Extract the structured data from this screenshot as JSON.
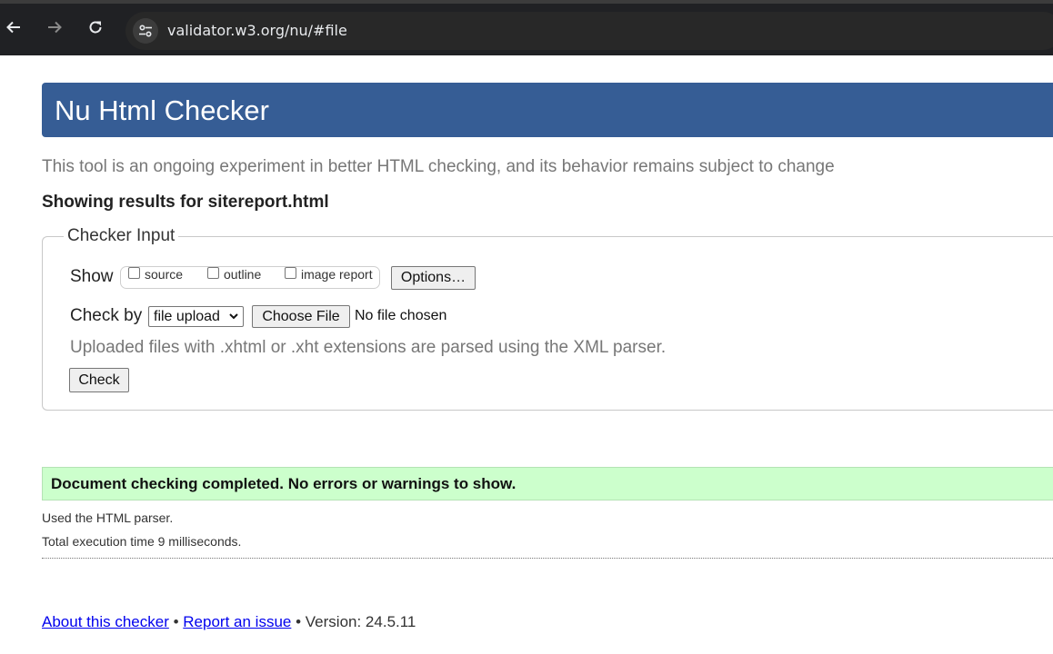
{
  "browser": {
    "back_icon": "arrow-left-icon",
    "forward_icon": "arrow-right-icon",
    "reload_icon": "reload-icon",
    "site_info_icon": "tune-icon",
    "url": "validator.w3.org/nu/#file"
  },
  "page": {
    "title": "Nu Html Checker",
    "tagline": "This tool is an ongoing experiment in better HTML checking, and its behavior remains subject to change",
    "showing_results": "Showing results for sitereport.html",
    "banner_color": "#365d95"
  },
  "checker_input": {
    "legend": "Checker Input",
    "show_label": "Show",
    "show_options": [
      {
        "label": "source",
        "checked": false
      },
      {
        "label": "outline",
        "checked": false
      },
      {
        "label": "image report",
        "checked": false
      }
    ],
    "options_button": "Options…",
    "check_by_label": "Check by",
    "check_by_selected": "file upload",
    "choose_file_button": "Choose File",
    "no_file_text": "No file chosen",
    "hint": "Uploaded files with .xhtml or .xht extensions are parsed using the XML parser.",
    "check_button": "Check"
  },
  "results": {
    "success_message": "Document checking completed. No errors or warnings to show.",
    "success_color": "#ccffcc",
    "parser_note": "Used the HTML parser.",
    "execution_time": "Total execution time 9 milliseconds."
  },
  "footer": {
    "about_link": "About this checker",
    "separator1": "•",
    "report_link": "Report an issue",
    "separator2": "•",
    "version": "Version: 24.5.11"
  }
}
